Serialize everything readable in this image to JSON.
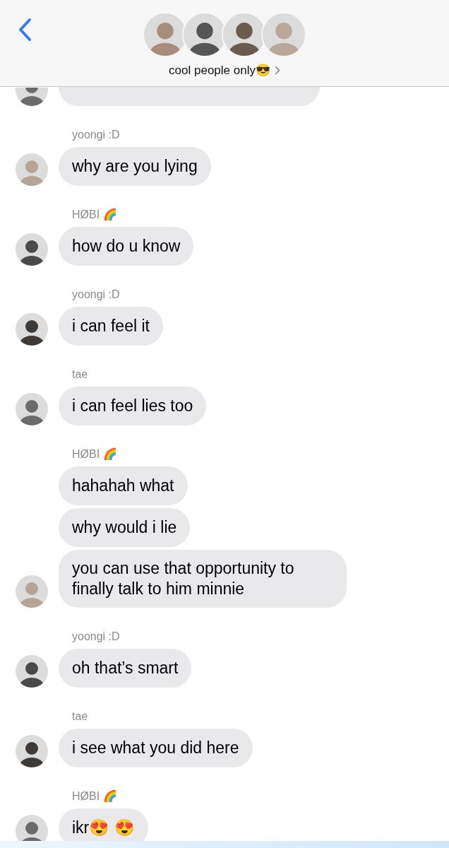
{
  "header": {
    "title": "cool people only😎"
  },
  "groups": [
    {
      "kind": "cut"
    },
    {
      "sender": "yoongi :D",
      "bubbles": [
        "why are you lying"
      ]
    },
    {
      "sender": "HØBI 🌈",
      "bubbles": [
        "how do u know"
      ]
    },
    {
      "sender": "yoongi :D",
      "bubbles": [
        "i can feel it"
      ]
    },
    {
      "sender": "tae",
      "bubbles": [
        "i can feel lies too"
      ]
    },
    {
      "sender": "HØBI 🌈",
      "bubbles": [
        "hahahah what",
        "why would i lie",
        "you can use that opportunity to finally talk to him minnie"
      ]
    },
    {
      "sender": "yoongi :D",
      "bubbles": [
        "oh that’s smart"
      ]
    },
    {
      "sender": "tae",
      "bubbles": [
        "i see what you did here"
      ]
    },
    {
      "sender": "HØBI 🌈",
      "bubbles": [
        "ikr😍 😍"
      ]
    }
  ]
}
